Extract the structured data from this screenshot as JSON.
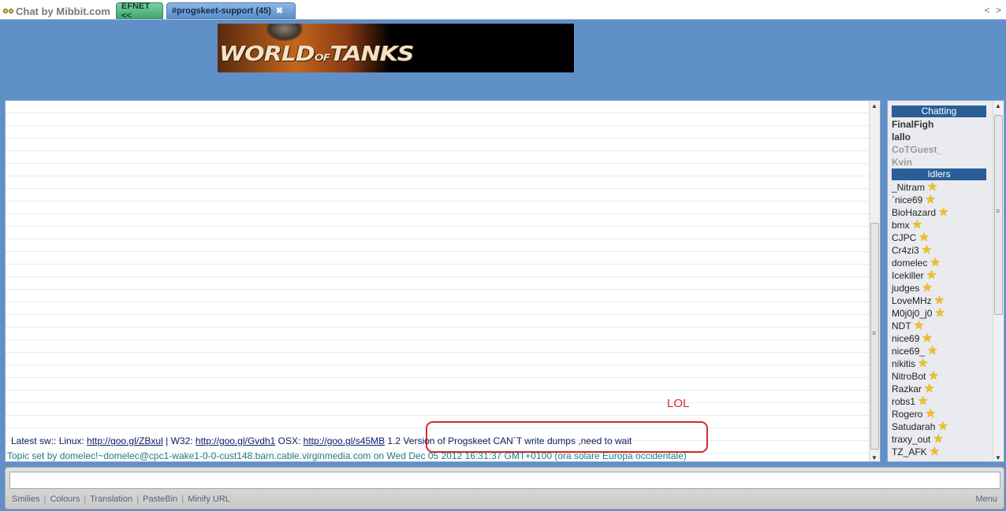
{
  "app": {
    "title": "Chat by Mibbit.com"
  },
  "tabs": [
    {
      "label": "EFNET <<"
    },
    {
      "label": "#progskeet-support (45)",
      "close": "✖"
    }
  ],
  "nav_arrows": "< >",
  "banner": {
    "text_left": "WORLD",
    "text_mid": "OF",
    "text_right": "TANKS"
  },
  "chat": {
    "message": {
      "prefix": "Latest sw:: Linux: ",
      "link1": "http://goo.gl/ZBxul",
      "mid1": " | W32: ",
      "link2": "http://goo.gl/Gvdh1",
      "mid2": " OSX: ",
      "link3": "http://goo.gl/s45MB",
      "suffix": " 1.2 Version of Progskeet CAN´T write dumps ,need to wait"
    },
    "topic": "Topic set by domelec!~domelec@cpc1-wake1-0-0-cust148.barn.cable.virginmedia.com on Wed Dec 05 2012 16:31:37 GMT+0100 (ora solare Europa occidentale)",
    "annotation": "LOL"
  },
  "users": {
    "chatting_header": "Chatting",
    "chatting": [
      "FinalFigh",
      "lallo",
      "CoTGuest_",
      "Kvin"
    ],
    "idlers_header": "Idlers",
    "idlers": [
      "_Nitram",
      "`nice69",
      "BioHazard",
      "bmx",
      "CJPC",
      "Cr4zi3",
      "domelec",
      "Icekiller",
      "judges",
      "LoveMHz",
      "M0j0j0_j0",
      "NDT",
      "nice69",
      "nice69_",
      "nikitis",
      "NitroBot",
      "Razkar",
      "robs1",
      "Rogero",
      "Satudarah",
      "traxy_out",
      "TZ_AFK"
    ]
  },
  "input": {
    "value": "",
    "placeholder": ""
  },
  "toolbar": {
    "smilies": "Smilies",
    "colours": "Colours",
    "translation": "Translation",
    "pastebin": "PasteBin",
    "minify": "Minify URL",
    "sep": "|",
    "menu": "Menu"
  }
}
